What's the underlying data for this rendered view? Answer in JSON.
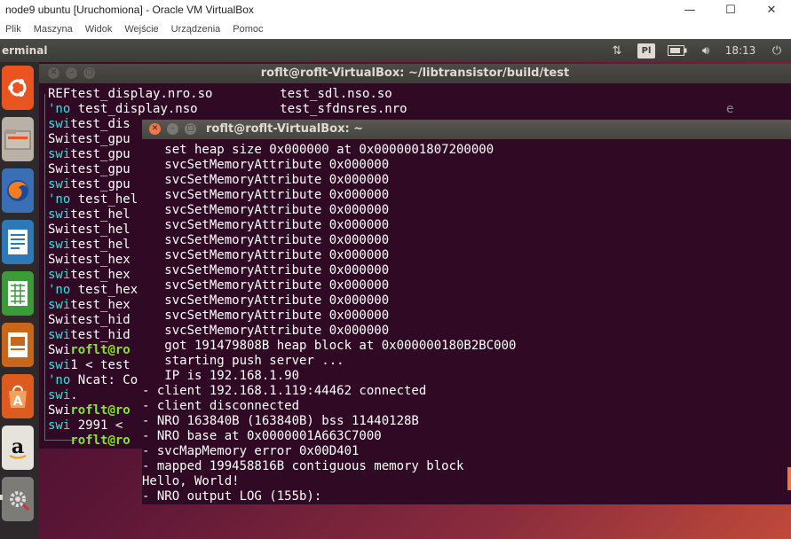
{
  "vbox": {
    "title": "node9 ubuntu [Uruchomiona] - Oracle VM VirtualBox",
    "controls": {
      "minimize": "—",
      "maximize": "☐",
      "close": "✕"
    },
    "menu": [
      "Plik",
      "Maszyna",
      "Widok",
      "Wejście",
      "Urządzenia",
      "Pomoc"
    ]
  },
  "panel": {
    "app_title": "erminal",
    "keyboard_layout": "Pl",
    "clock": "18:13",
    "tray_icons": [
      "network-updown-icon",
      "keyboard-indicator",
      "battery-icon",
      "volume-icon",
      "power-icon"
    ]
  },
  "launcher": {
    "items": [
      "ubuntu-dash-icon",
      "files-icon",
      "firefox-icon",
      "libreoffice-writer-icon",
      "libreoffice-calc-icon",
      "libreoffice-impress-icon",
      "software-center-icon",
      "amazon-icon",
      "system-settings-icon"
    ]
  },
  "back_terminal": {
    "title": "roflt@roflt-VirtualBox: ~/libtransistor/build/test",
    "right_fragment": "e",
    "lines": [
      [
        "",
        "REF",
        "test_display.nro.so         test_sdl.nso.so"
      ],
      [
        "cyan",
        "'no",
        " test_display.nso           test_sfdnsres.nro"
      ],
      [
        "cyan",
        "swi",
        "test_dis"
      ],
      [
        "",
        "Swi",
        "test_gpu"
      ],
      [
        "cyan",
        "swi",
        "test_gpu"
      ],
      [
        "",
        "Swi",
        "test_gpu"
      ],
      [
        "cyan",
        "swi",
        "test_gpu"
      ],
      [
        "cyan",
        "'no",
        " test_hel"
      ],
      [
        "cyan",
        "swi",
        "test_hel"
      ],
      [
        "",
        "Swi",
        "test_hel"
      ],
      [
        "cyan",
        "swi",
        "test_hel"
      ],
      [
        "",
        "Swi",
        "test_hex"
      ],
      [
        "cyan",
        "swi",
        "test_hex"
      ],
      [
        "cyan",
        "'no",
        " test_hex"
      ],
      [
        "cyan",
        "swi",
        "test_hex"
      ],
      [
        "",
        "Swi",
        "test_hid"
      ],
      [
        "cyan",
        "swi",
        "test_hid"
      ],
      [
        "",
        "Swi",
        "roflt@ro"
      ],
      [
        "cyan",
        "swi",
        "1 < test"
      ],
      [
        "cyan",
        "'no",
        " Ncat: Co"
      ],
      [
        "cyan",
        "swi",
        "."
      ],
      [
        "",
        "Swi",
        "roflt@ro"
      ],
      [
        "cyan",
        "swi",
        " 2991 < "
      ],
      [
        "",
        "   ",
        "roflt@ro"
      ]
    ]
  },
  "front_terminal": {
    "title": "roflt@roflt-VirtualBox: ~",
    "lines": [
      "   set heap size 0x000000 at 0x0000001807200000",
      "   svcSetMemoryAttribute 0x000000",
      "   svcSetMemoryAttribute 0x000000",
      "   svcSetMemoryAttribute 0x000000",
      "   svcSetMemoryAttribute 0x000000",
      "   svcSetMemoryAttribute 0x000000",
      "   svcSetMemoryAttribute 0x000000",
      "   svcSetMemoryAttribute 0x000000",
      "   svcSetMemoryAttribute 0x000000",
      "   svcSetMemoryAttribute 0x000000",
      "   svcSetMemoryAttribute 0x000000",
      "   svcSetMemoryAttribute 0x000000",
      "   svcSetMemoryAttribute 0x000000",
      "   got 191479808B heap block at 0x000000180B2BC000",
      "   starting push server ...",
      "   IP is 192.168.1.90",
      "- client 192.168.1.119:44462 connected",
      "- client disconnected",
      "- NRO 163840B (163840B) bss 11440128B",
      "- NRO base at 0x0000001A663C7000",
      "- svcMapMemory error 0x00D401",
      "- mapped 199458816B contiguous memory block",
      "Hello, World!",
      "- NRO output LOG (155b):"
    ]
  }
}
